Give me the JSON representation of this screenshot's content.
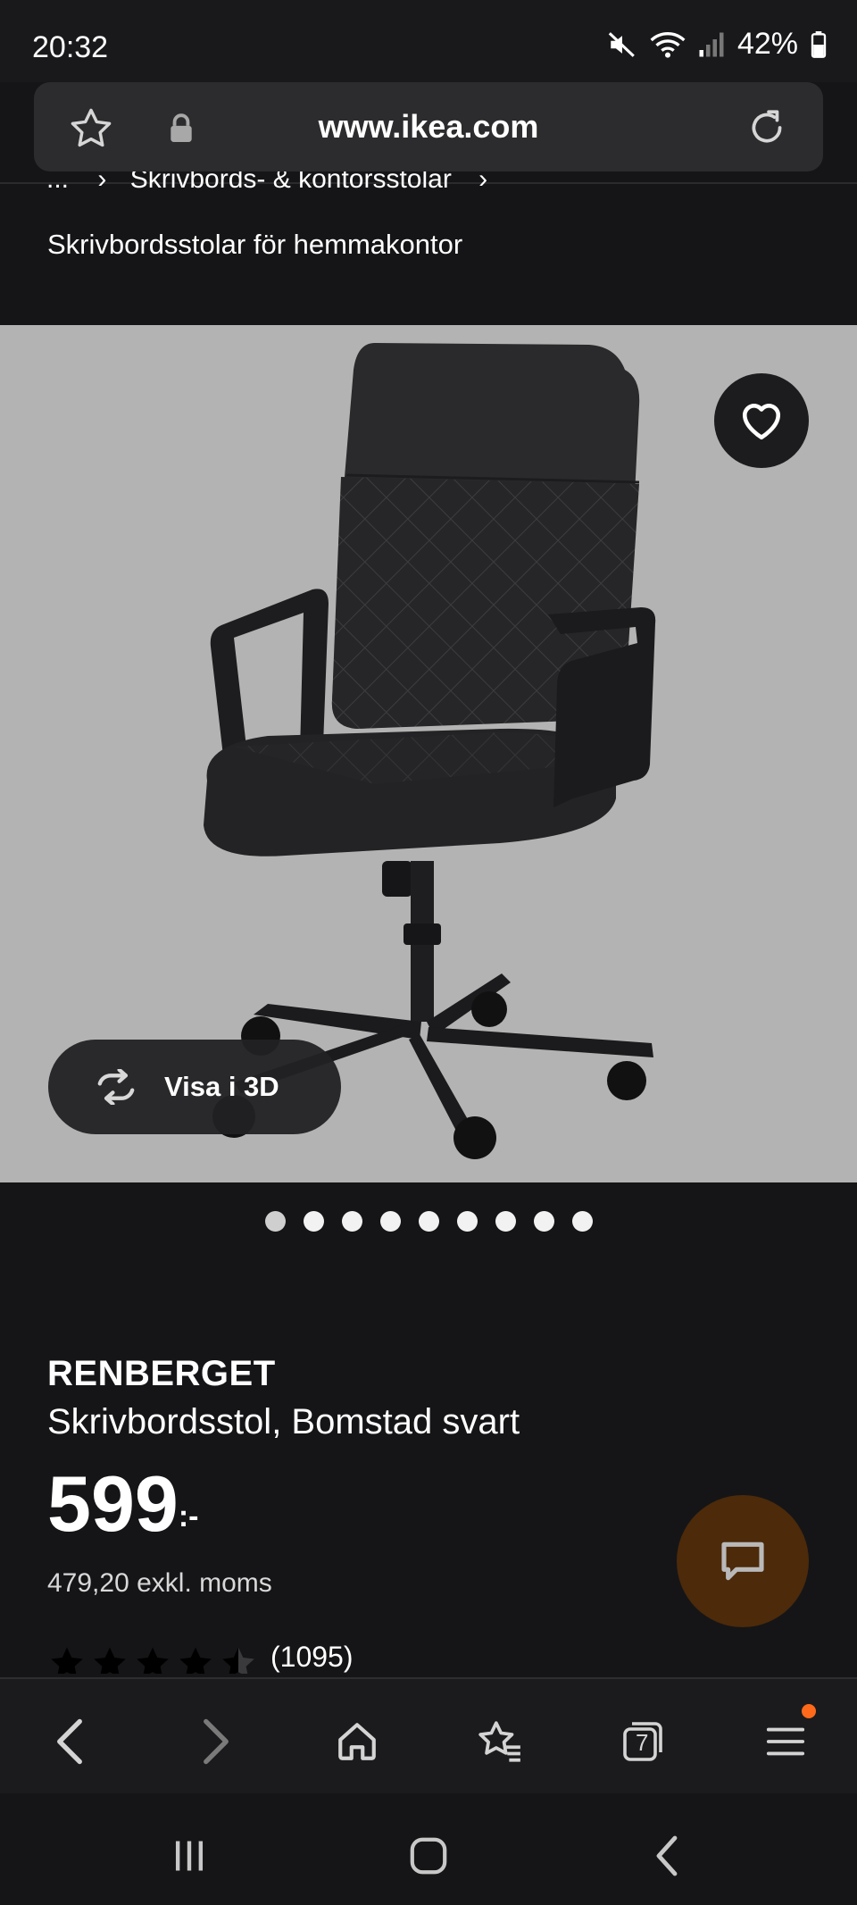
{
  "status": {
    "time": "20:32",
    "battery": "42%"
  },
  "browser": {
    "url": "www.ikea.com"
  },
  "breadcrumb": {
    "ellipsis": "...",
    "item": "Skrivbords- & kontorsstolar"
  },
  "category_title": "Skrivbordsstolar för hemmakontor",
  "gallery": {
    "view3d_label": "Visa i 3D",
    "dot_count": 9,
    "active_dot": 0
  },
  "product": {
    "name": "RENBERGET",
    "description": "Skrivbordsstol, Bomstad svart",
    "price": "599",
    "price_suffix": ":-",
    "price_ex_vat": "479,20 exkl. moms",
    "rating": 4.5,
    "rating_count": "(1095)"
  },
  "toolbar": {
    "tab_count": "7",
    "has_notification": true
  },
  "colors": {
    "background": "#151517",
    "image_bg": "#b3b3b3",
    "chat_button": "#4c2a0a",
    "notification_dot": "#ff6a1a"
  }
}
